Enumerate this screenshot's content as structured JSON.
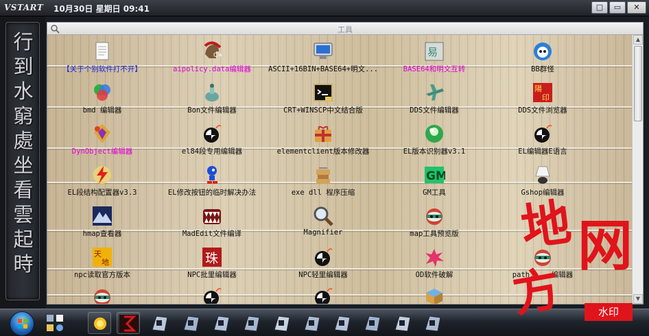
{
  "titlebar": {
    "logo": "VSTART",
    "datetime": "10月30日  星期日  09:41"
  },
  "window_controls": [
    "□",
    "▭",
    "✕"
  ],
  "banner": {
    "text": "行到水窮處坐看雲起時"
  },
  "toolbar": {
    "title": "工具"
  },
  "items": [
    {
      "label": "【关于个别软件打不开】",
      "color": "blue",
      "icon": "document-icon"
    },
    {
      "label": "aipolicy.data编辑器",
      "color": "pink",
      "icon": "spartan-helmet-icon"
    },
    {
      "label": "ASCII+16BIN+BASE64+明文...",
      "color": "black",
      "icon": "monitor-icon"
    },
    {
      "label": "BASE64和明文互转",
      "color": "pink",
      "icon": "stamp-icon"
    },
    {
      "label": "BB群怪",
      "color": "black",
      "icon": "blue-ghost-icon"
    },
    {
      "label": "bmd 编辑器",
      "color": "black",
      "icon": "rgb-circles-icon"
    },
    {
      "label": "Bon文件编辑器",
      "color": "black",
      "icon": "teal-bottle-icon"
    },
    {
      "label": "CRT+WINSCP中文结合版",
      "color": "black",
      "icon": "terminal-icon"
    },
    {
      "label": "DDS文件编辑器",
      "color": "black",
      "icon": "plane-icon"
    },
    {
      "label": "DDS文件浏览器",
      "color": "black",
      "icon": "red-seal-icon"
    },
    {
      "label": "DynObject编辑器",
      "color": "pink",
      "icon": "crystal-icon"
    },
    {
      "label": "el84段专用编辑器",
      "color": "black",
      "icon": "bomb-icon"
    },
    {
      "label": "elementclient版本修改器",
      "color": "black",
      "icon": "gift-icon"
    },
    {
      "label": "EL版本识别器v3.1",
      "color": "black",
      "icon": "green-orb-icon"
    },
    {
      "label": "EL编辑器E语言",
      "color": "black",
      "icon": "bomb-icon"
    },
    {
      "label": "EL段结构配置器v3.3",
      "color": "black",
      "icon": "lightning-icon"
    },
    {
      "label": "EL修改按钮的临时解决办法",
      "color": "black",
      "icon": "sonic-icon"
    },
    {
      "label": "exe dll 程序压缩",
      "color": "black",
      "icon": "box-stack-icon"
    },
    {
      "label": "GM工具",
      "color": "black",
      "icon": "gm-logo-icon"
    },
    {
      "label": "Gshop编辑器",
      "color": "black",
      "icon": "shuttlecock-icon"
    },
    {
      "label": "hmap查看器",
      "color": "black",
      "icon": "mountain-icon"
    },
    {
      "label": "MadEdit文件编译",
      "color": "black",
      "icon": "teeth-icon"
    },
    {
      "label": "Magnifier",
      "color": "black",
      "icon": "magnifier-icon"
    },
    {
      "label": "map工具预览版",
      "color": "black",
      "icon": "ninja-mask-icon"
    },
    {
      "label": "",
      "color": "black",
      "icon": "none"
    },
    {
      "label": "npc读取官方版本",
      "color": "black",
      "icon": "gold-seal-icon"
    },
    {
      "label": "NPC批里编辑器",
      "color": "black",
      "icon": "red-tile-icon"
    },
    {
      "label": "NPC轻里编辑器",
      "color": "black",
      "icon": "bomb-icon"
    },
    {
      "label": "OD软件破解",
      "color": "black",
      "icon": "splat-icon"
    },
    {
      "label": "path.... 编辑器",
      "color": "black",
      "icon": "ninja-mask-icon"
    },
    {
      "label": "",
      "color": "black",
      "icon": "ninja-mask-icon"
    },
    {
      "label": "",
      "color": "black",
      "icon": "bomb-icon"
    },
    {
      "label": "",
      "color": "black",
      "icon": "bomb-icon"
    },
    {
      "label": "",
      "color": "black",
      "icon": "package-icon"
    },
    {
      "label": "",
      "color": "black",
      "icon": "none"
    }
  ],
  "taskbar": {
    "buttons": [
      "start-orb",
      "tray-mini-icons",
      "sun-icon",
      "red-glyph-icon",
      "app1",
      "app2",
      "app3",
      "app4",
      "app5",
      "app6",
      "app7",
      "app8",
      "app9",
      "app10"
    ]
  },
  "watermark": {
    "big": "地方网",
    "stamp": "水印"
  }
}
